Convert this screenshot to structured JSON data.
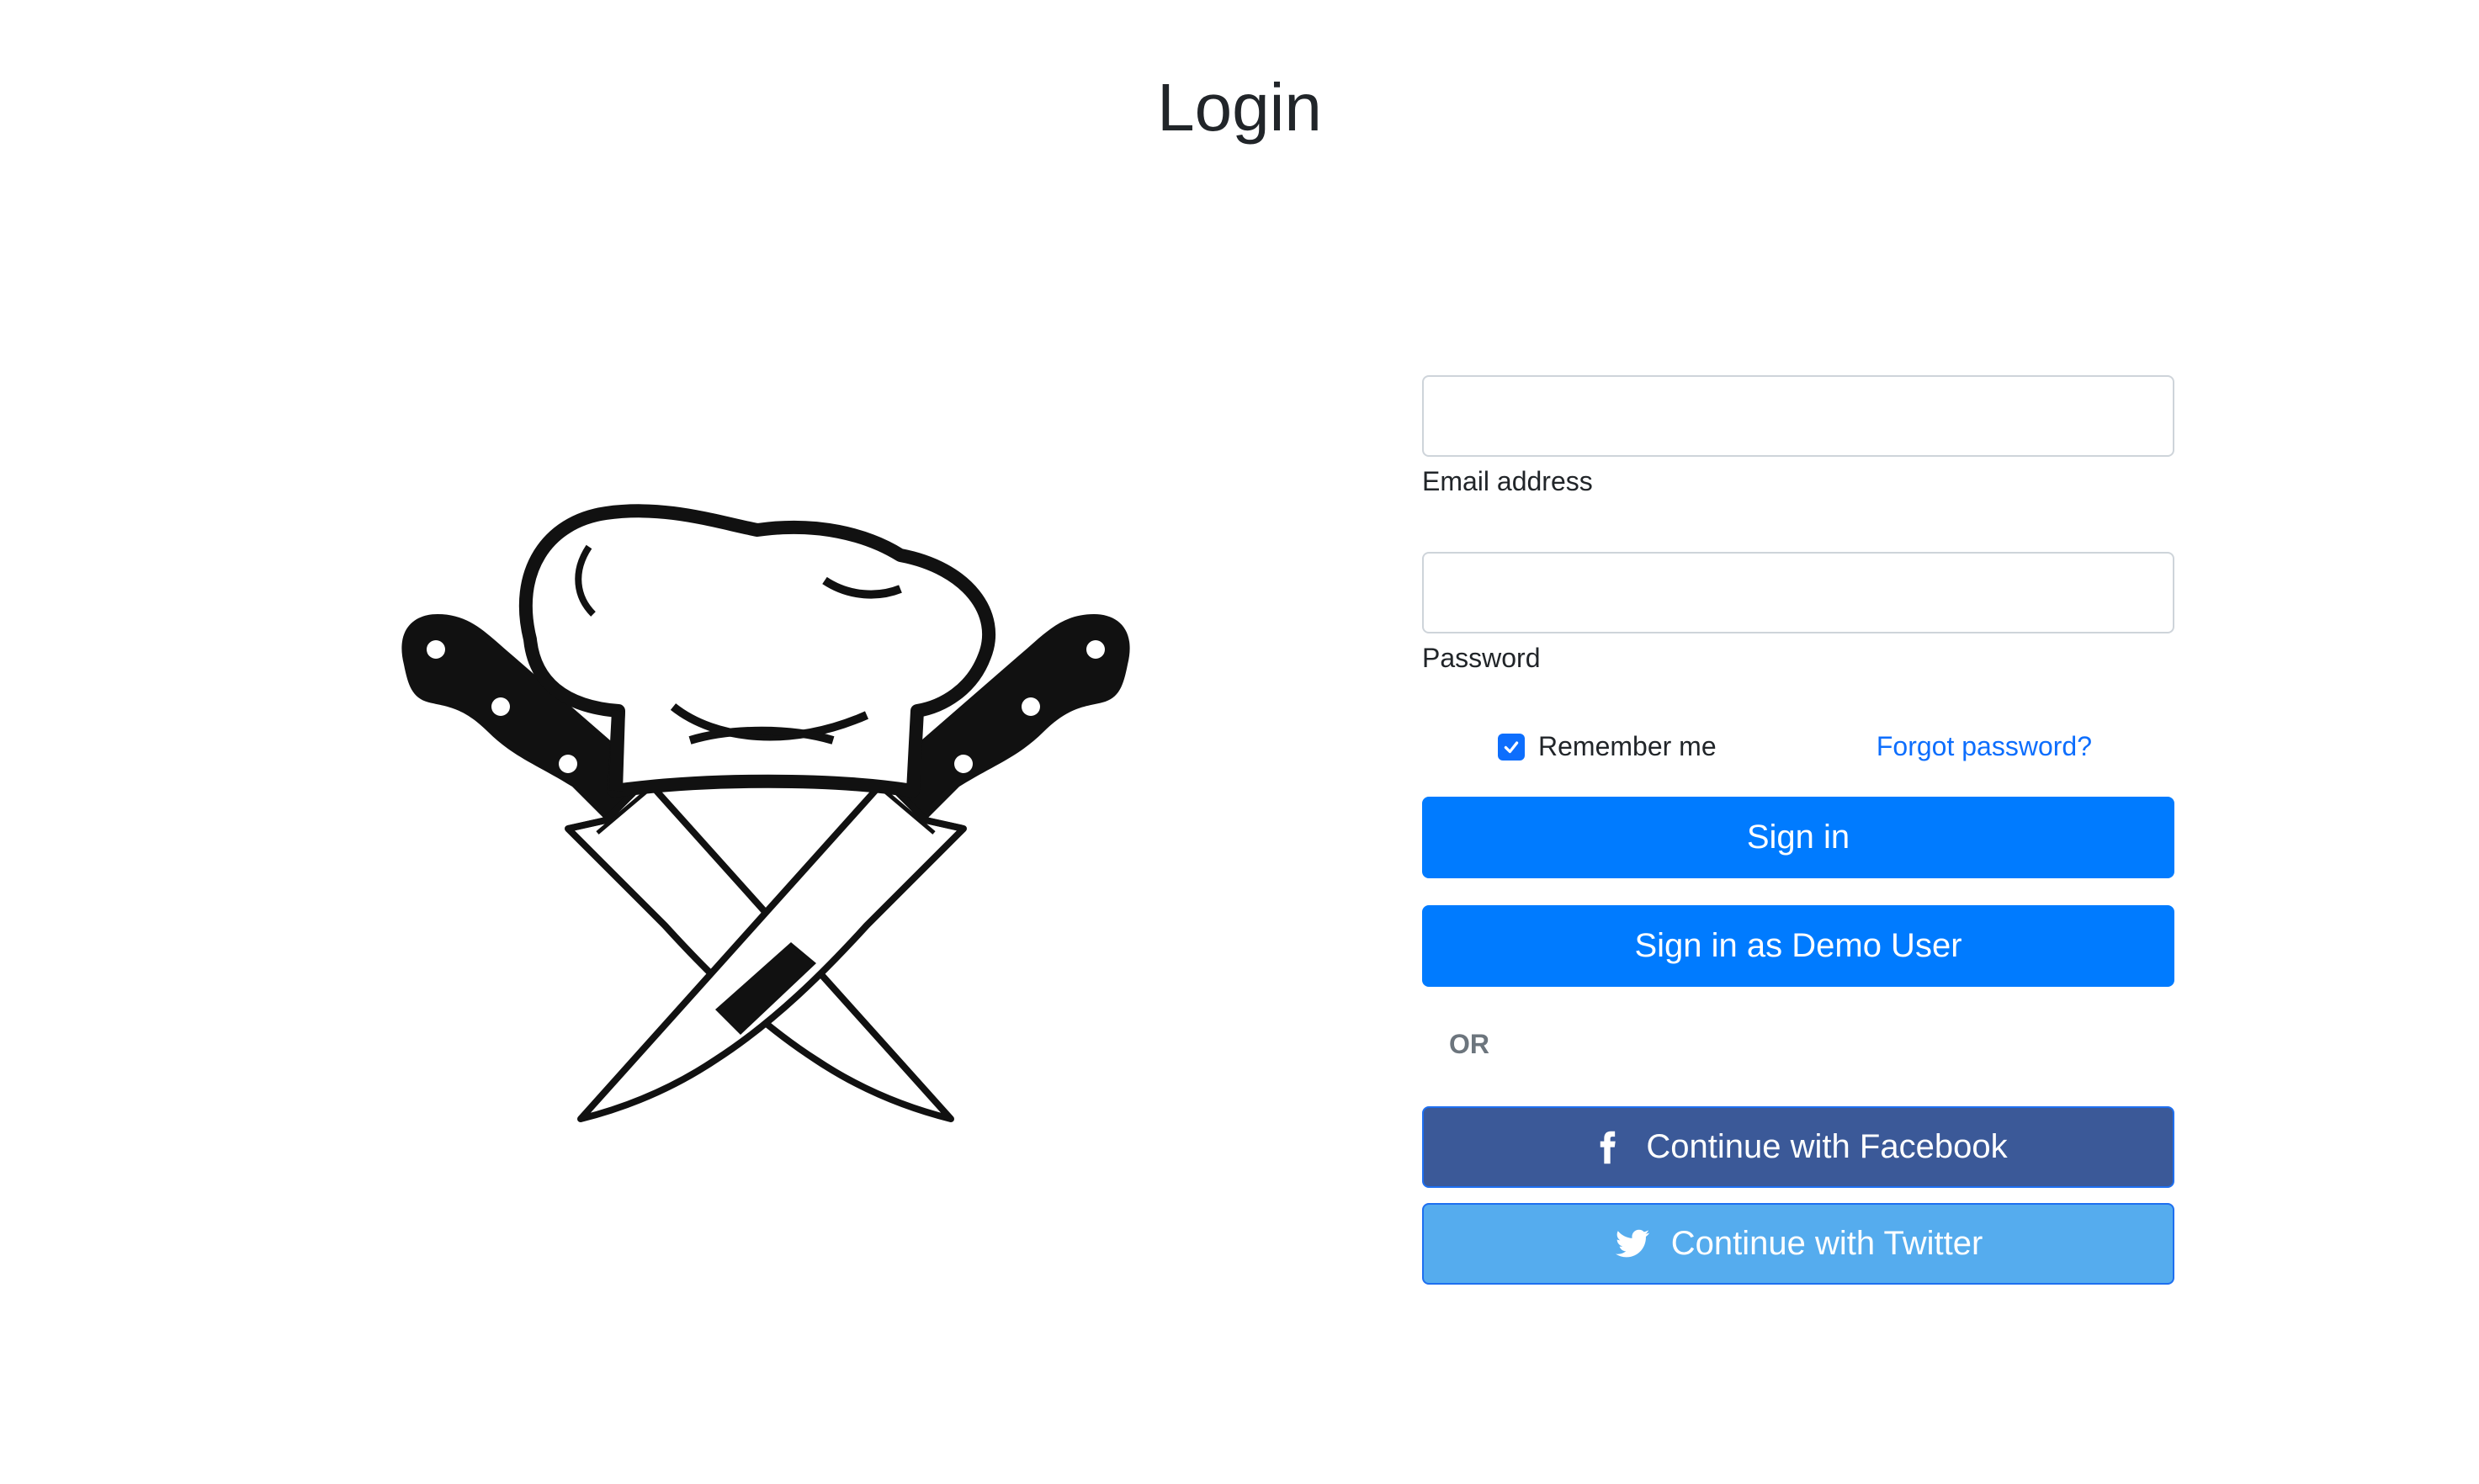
{
  "header": {
    "title": "Login"
  },
  "illustration": {
    "icon": "chef-hat-crossed-knives-icon"
  },
  "form": {
    "email": {
      "value": "",
      "placeholder": "",
      "label": "Email address"
    },
    "password": {
      "value": "",
      "placeholder": "",
      "label": "Password"
    },
    "remember": {
      "label": "Remember me",
      "checked": true
    },
    "forgot_label": "Forgot password?",
    "signin_label": "Sign in",
    "demo_label": "Sign in as Demo User",
    "or_label": "OR",
    "facebook": {
      "label": "Continue with Facebook",
      "icon": "facebook-icon",
      "color": "#3b5998"
    },
    "twitter": {
      "label": "Continue with Twitter",
      "icon": "twitter-icon",
      "color": "#55acee"
    }
  },
  "colors": {
    "primary": "#007bff",
    "link": "#0d6efd",
    "muted": "#6c757d"
  }
}
